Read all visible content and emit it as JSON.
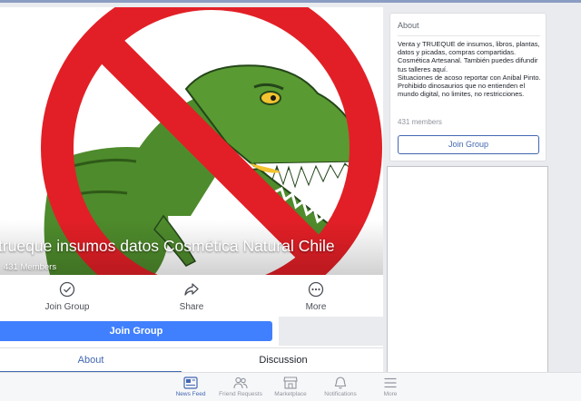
{
  "group": {
    "name": "trueque insumos datos Cosmética Natural Chile",
    "members": "431 Members"
  },
  "actions": [
    {
      "label": "Join Group",
      "icon": "check-circle-icon"
    },
    {
      "label": "Share",
      "icon": "share-arrow-icon"
    },
    {
      "label": "More",
      "icon": "more-dots-icon"
    }
  ],
  "join_button": "Join Group",
  "tabs": [
    {
      "label": "About",
      "active": true
    },
    {
      "label": "Discussion",
      "active": false
    }
  ],
  "about": {
    "title": "About",
    "description": "Venta y TRUEQUE de insumos, libros, plantas, datos y picadas, compras compartidas.\nCosmética Artesanal. También puedes difundir tus talleres aquí.\nSituaciones de acoso reportar con Anibal Pinto.\nProhibido dinosaurios que no entienden el mundo digital, no limites, no restricciones.",
    "members": "431 members",
    "join_label": "Join Group"
  },
  "bottom_nav": [
    {
      "label": "News Feed",
      "icon": "news-feed-icon",
      "active": true
    },
    {
      "label": "Friend Requests",
      "icon": "friends-icon",
      "active": false
    },
    {
      "label": "Marketplace",
      "icon": "marketplace-icon",
      "active": false
    },
    {
      "label": "Notifications",
      "icon": "bell-icon",
      "active": false
    },
    {
      "label": "More",
      "icon": "menu-icon",
      "active": false
    }
  ],
  "colors": {
    "accent": "#4267b2",
    "button": "#4080ff",
    "prohibition_red": "#e21f26",
    "dino_green": "#4e8b2c"
  }
}
